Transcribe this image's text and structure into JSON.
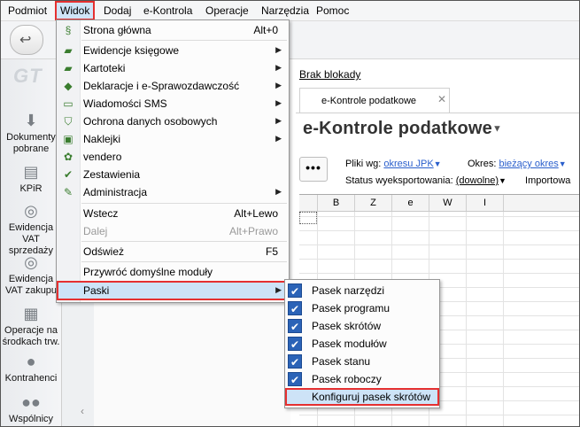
{
  "menubar": [
    "Podmiot",
    "Widok",
    "Dodaj",
    "e-Kontrola",
    "Operacje",
    "Narzędzia",
    "Pomoc"
  ],
  "menu": {
    "items": [
      {
        "label": "Strona główna",
        "shortcut": "Alt+0",
        "icon": "home-icon"
      },
      {
        "label": "Ewidencje księgowe",
        "icon": "ledger-icon",
        "submenu": true
      },
      {
        "label": "Kartoteki",
        "icon": "cards-icon",
        "submenu": true
      },
      {
        "label": "Deklaracje i e-Sprawozdawczość",
        "icon": "declaration-icon",
        "submenu": true
      },
      {
        "label": "Wiadomości SMS",
        "icon": "sms-icon",
        "submenu": true
      },
      {
        "label": "Ochrona danych osobowych",
        "icon": "shield-icon",
        "submenu": true
      },
      {
        "label": "Naklejki",
        "icon": "sticker-icon",
        "submenu": true
      },
      {
        "label": "vendero",
        "icon": "vendero-icon"
      },
      {
        "label": "Zestawienia",
        "icon": "report-icon"
      },
      {
        "label": "Administracja",
        "icon": "admin-icon",
        "submenu": true
      },
      {
        "label": "Wstecz",
        "shortcut": "Alt+Lewo"
      },
      {
        "label": "Dalej",
        "shortcut": "Alt+Prawo",
        "disabled": true
      },
      {
        "label": "Odśwież",
        "shortcut": "F5"
      },
      {
        "label": "Przywróć domyślne moduły"
      },
      {
        "label": "Paski",
        "submenu": true
      }
    ]
  },
  "submenu": {
    "items": [
      {
        "label": "Pasek narzędzi",
        "checked": true
      },
      {
        "label": "Pasek programu",
        "checked": true
      },
      {
        "label": "Pasek skrótów",
        "checked": true
      },
      {
        "label": "Pasek modułów",
        "checked": true
      },
      {
        "label": "Pasek stanu",
        "checked": true
      },
      {
        "label": "Pasek roboczy",
        "checked": true
      },
      {
        "label": "Konfiguruj pasek skrótów"
      }
    ]
  },
  "sidebar": {
    "logo": "GT",
    "items": [
      {
        "label": "Dokumenty pobrane",
        "icon": "download-icon"
      },
      {
        "label": "KPiR",
        "icon": "book-icon"
      },
      {
        "label": "Ewidencja VAT sprzedaży",
        "icon": "coins-icon"
      },
      {
        "label": "Ewidencja VAT zakupu",
        "icon": "coins-icon"
      },
      {
        "label": "Operacje na środkach trw.",
        "icon": "assets-icon"
      },
      {
        "label": "Kontrahenci",
        "icon": "person-icon"
      },
      {
        "label": "Wspólnicy",
        "icon": "people-icon"
      }
    ]
  },
  "main": {
    "block_link": "Brak blokady",
    "tab_label": "e-Kontrole podatkowe",
    "title": "e-Kontrole podatkowe",
    "dots": "•••",
    "filters": {
      "pliki_label": "Pliki wg:",
      "pliki_value": "okresu JPK",
      "okres_label": "Okres:",
      "okres_value": "bieżący okres",
      "status_label": "Status wyeksportowania:",
      "status_value": "(dowolne)",
      "import_label": "Importowa"
    },
    "grid_headers": [
      "B",
      "Z",
      "e",
      "W",
      "I"
    ]
  },
  "colors": {
    "highlight": "#cde3f7",
    "outline": "#e53030",
    "link": "#2a5fcc",
    "check": "#2b63b7"
  }
}
